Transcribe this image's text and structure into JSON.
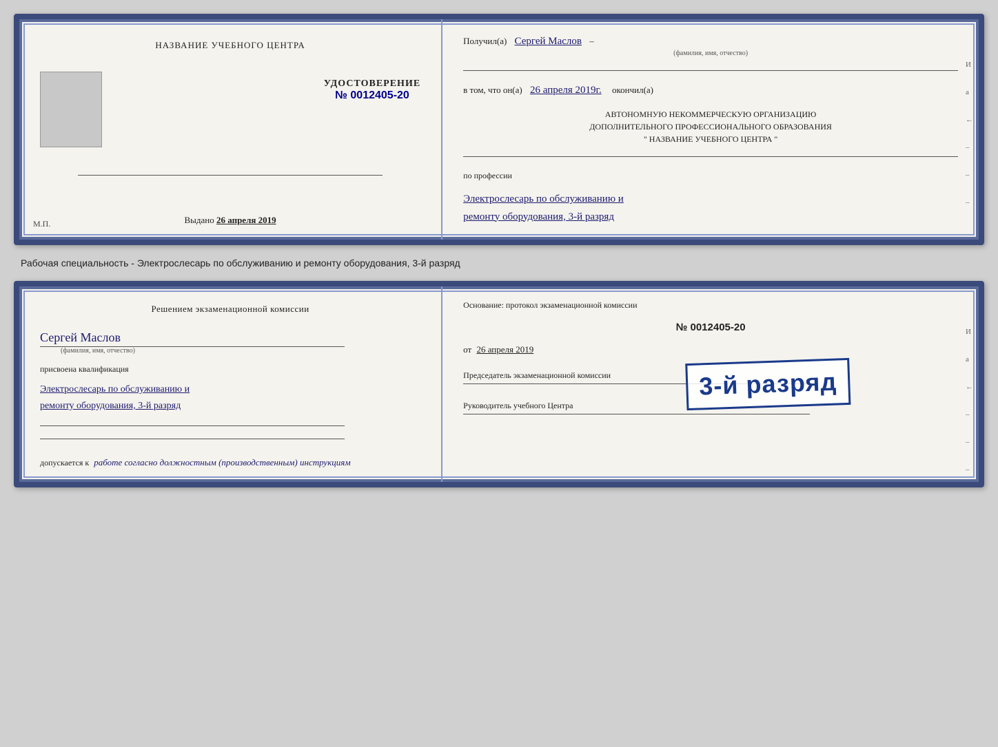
{
  "doc1": {
    "left": {
      "center_title": "НАЗВАНИЕ УЧЕБНОГО ЦЕНТРА",
      "photo_alt": "фото",
      "udost_label": "УДОСТОВЕРЕНИЕ",
      "udost_number": "№ 0012405-20",
      "vydano_label": "Выдано",
      "vydano_date": "26 апреля 2019",
      "mp": "М.П."
    },
    "right": {
      "poluchil_prefix": "Получил(а)",
      "poluchil_name": "Сергей Маслов",
      "fio_label": "(фамилия, имя, отчество)",
      "dash": "–",
      "vtom_prefix": "в том, что он(а)",
      "vtom_date": "26 апреля 2019г.",
      "okончил": "окончил(а)",
      "org_line1": "АВТОНОМНУЮ НЕКОММЕРЧЕСКУЮ ОРГАНИЗАЦИЮ",
      "org_line2": "ДОПОЛНИТЕЛЬНОГО ПРОФЕССИОНАЛЬНОГО ОБРАЗОВАНИЯ",
      "org_line3": "\"  НАЗВАНИЕ УЧЕБНОГО ЦЕНТРА  \"",
      "po_professii": "по профессии",
      "profession_line1": "Электрослесарь по обслуживанию и",
      "profession_line2": "ремонту оборудования, 3-й разряд",
      "margin_notes": [
        "И",
        "а",
        "←",
        "–",
        "–",
        "–"
      ]
    }
  },
  "between_label": "Рабочая специальность - Электрослесарь по обслуживанию и ремонту оборудования, 3-й разряд",
  "doc2": {
    "left": {
      "decision_title": "Решением экзаменационной комиссии",
      "name": "Сергей Маслов",
      "fio_label": "(фамилия, имя, отчество)",
      "prisvoena": "присвоена квалификация",
      "qualification_line1": "Электрослесарь по обслуживанию и",
      "qualification_line2": "ремонту оборудования, 3-й разряд",
      "line1": "",
      "line2": "",
      "dopusk_label": "допускается к",
      "dopusk_text": "работе согласно должностным (производственным) инструкциям"
    },
    "right": {
      "osnov_label": "Основание: протокол экзаменационной комиссии",
      "protocol_number": "№  0012405-20",
      "ot_label": "от",
      "ot_date": "26 апреля 2019",
      "predsedatel_label": "Председатель экзаменационной комиссии",
      "rukovoditel_label": "Руководитель учебного Центра",
      "margin_notes": [
        "И",
        "а",
        "←",
        "–",
        "–",
        "–"
      ]
    },
    "stamp": {
      "text": "3-й разряд"
    }
  }
}
